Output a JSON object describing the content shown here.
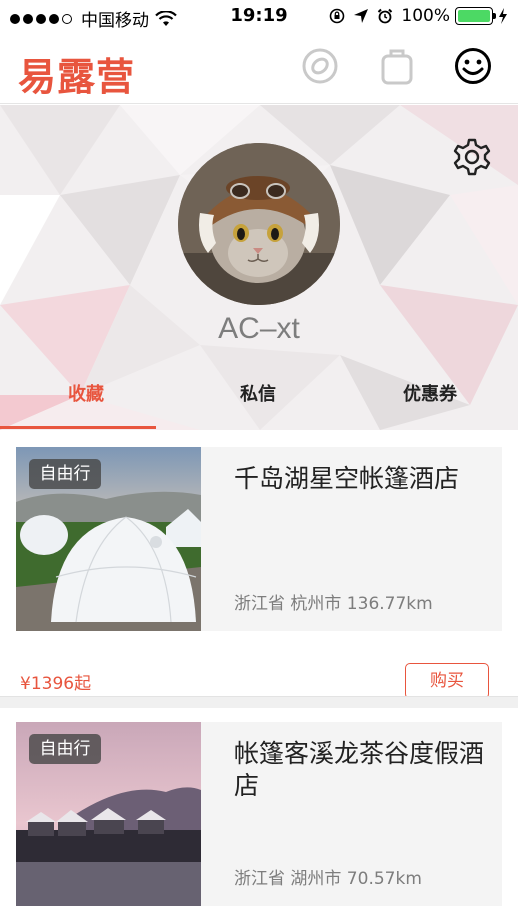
{
  "status_bar": {
    "carrier": "中国移动",
    "time": "19:19",
    "battery_percent": "100%",
    "signal_bars": 4,
    "icons": [
      "rotation-lock-icon",
      "location-arrow-icon",
      "alarm-icon",
      "charging-bolt-icon"
    ]
  },
  "header": {
    "logo": "易露营",
    "icons": [
      "discover-icon",
      "bag-icon",
      "smiley-profile-icon"
    ]
  },
  "profile": {
    "username": "AC–xt",
    "avatar": "cat-with-aviator-hat-avatar",
    "settings_icon": "gear-icon"
  },
  "tabs": [
    {
      "label": "收藏",
      "active": true
    },
    {
      "label": "私信",
      "active": false
    },
    {
      "label": "优惠券",
      "active": false
    }
  ],
  "listings": [
    {
      "tag": "自由行",
      "title": "千岛湖星空帐篷酒店",
      "location": "浙江省 杭州市 136.77km",
      "price": "¥1396起",
      "buy_label": "购买"
    },
    {
      "tag": "自由行",
      "title": "帐篷客溪龙茶谷度假酒店",
      "location": "浙江省 湖州市 70.57km"
    }
  ],
  "colors": {
    "accent": "#e8553e",
    "battery": "#4cd964",
    "card_bg": "#f4f4f4"
  }
}
